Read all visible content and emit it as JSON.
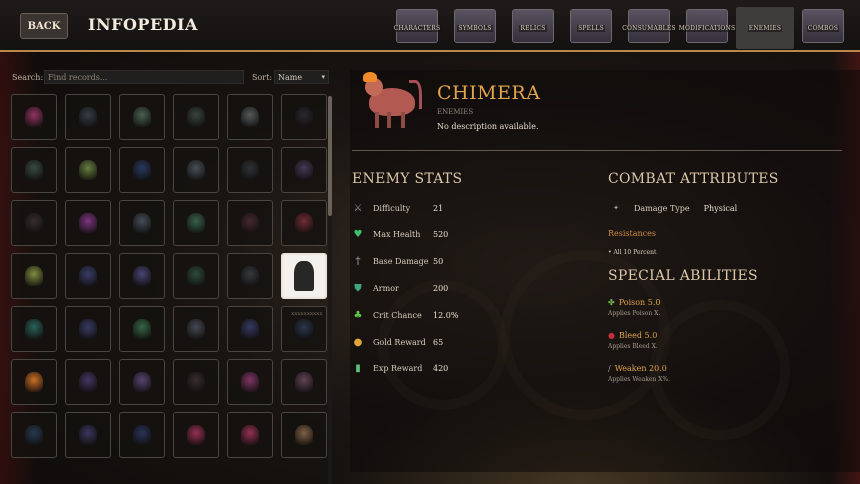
{
  "header": {
    "back_label": "BACK",
    "title": "INFOPEDIA",
    "tabs": [
      {
        "label": "CHARACTERS",
        "active": false
      },
      {
        "label": "SYMBOLS",
        "active": false
      },
      {
        "label": "RELICS",
        "active": false
      },
      {
        "label": "SPELLS",
        "active": false
      },
      {
        "label": "CONSUMABLES",
        "active": false
      },
      {
        "label": "MODIFICATIONS",
        "active": false
      },
      {
        "label": "ENEMIES",
        "active": true
      },
      {
        "label": "COMBOS",
        "active": false
      }
    ]
  },
  "browser": {
    "search_label": "Search:",
    "search_placeholder": "Find records...",
    "search_value": "",
    "sort_label": "Sort:",
    "sort_value": "Name",
    "selected_caption": "XXXXXXXXXX",
    "sprite_colors": [
      "#a0386a",
      "#39424d",
      "#4f6b56",
      "#3d4a42",
      "#5d6264",
      "#2d2b33",
      "#3e5247",
      "#6f8a45",
      "#2c3e6a",
      "#4e5660",
      "#31363a",
      "#4a3d5c",
      "#3a3032",
      "#8a3a8e",
      "#4a5560",
      "#3c6b52",
      "#4a2c33",
      "#7a3038",
      "#8a9a45",
      "#3d4270",
      "#4e4a7e",
      "#2f5240",
      "#3a3e44",
      "#111111",
      "#2e6a62",
      "#3b3f6a",
      "#3c6f4b",
      "#4a4f5a",
      "#3a3e6a",
      "#2e3a55",
      "#e07a2a",
      "#4a3a6a",
      "#5e4a7a",
      "#3a3032",
      "#8a3a6e",
      "#6a4a5e",
      "#2a3e58",
      "#3f3a68",
      "#2f3760",
      "#a2345a",
      "#a2345a",
      "#8a6a4a"
    ]
  },
  "detail": {
    "name": "CHIMERA",
    "category": "ENEMIES",
    "description": "No description available.",
    "stats_title": "ENEMY STATS",
    "stats": [
      {
        "icon": "crossed-swords-icon",
        "glyph": "⚔",
        "color": "#8d8e94",
        "name": "Difficulty",
        "value": "21"
      },
      {
        "icon": "heart-icon",
        "glyph": "♥",
        "color": "#3cbf6a",
        "name": "Max Health",
        "value": "520"
      },
      {
        "icon": "sword-icon",
        "glyph": "†",
        "color": "#b8b8bc",
        "name": "Base Damage",
        "value": "50"
      },
      {
        "icon": "shield-icon",
        "glyph": "⛊",
        "color": "#3fa57a",
        "name": "Armor",
        "value": "200"
      },
      {
        "icon": "clover-icon",
        "glyph": "♣",
        "color": "#5fbf4a",
        "name": "Crit Chance",
        "value": "12.0%"
      },
      {
        "icon": "coins-icon",
        "glyph": "●",
        "color": "#e0a63a",
        "name": "Gold Reward",
        "value": "65"
      },
      {
        "icon": "potion-icon",
        "glyph": "▮",
        "color": "#5cc07a",
        "name": "Exp Reward",
        "value": "420"
      }
    ],
    "combat_title": "COMBAT ATTRIBUTES",
    "damage_type_label": "Damage Type",
    "damage_type_value": "Physical",
    "resistances_title": "Resistances",
    "resistances_item": "• All 10 Percent",
    "abilities_title": "SPECIAL ABILITIES",
    "abilities": [
      {
        "icon": "poison-icon",
        "glyph": "✤",
        "color": "#7cc04a",
        "name": "Poison 5.0",
        "desc": "Applies Poison X."
      },
      {
        "icon": "blood-drop-icon",
        "glyph": "●",
        "color": "#c0303a",
        "name": "Bleed 5.0",
        "desc": "Applies Bleed X."
      },
      {
        "icon": "dagger-icon",
        "glyph": "/",
        "color": "#a89c8c",
        "name": "Weaken 20.0",
        "desc": "Applies Weaken X%."
      }
    ]
  }
}
